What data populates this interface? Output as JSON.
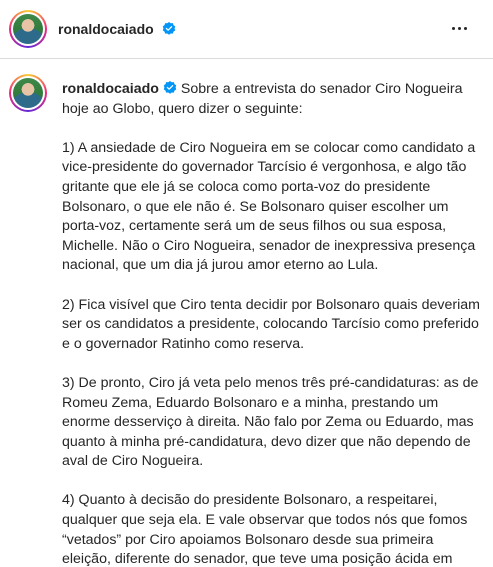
{
  "header": {
    "username": "ronaldocaiado",
    "more_icon": "more-horizontal-icon",
    "verified_icon": "verified-badge-icon",
    "verified_color": "#0095f6"
  },
  "caption": {
    "username": "ronaldocaiado",
    "intro": "Sobre a entrevista do senador Ciro Nogueira hoje ao Globo, quero dizer o seguinte:",
    "paragraphs": [
      "1) A ansiedade de Ciro Nogueira em se colocar como candidato a vice-presidente do governador Tarcísio é vergonhosa, e algo tão gritante que ele já se coloca como porta-voz do presidente Bolsonaro, o que ele não é. Se Bolsonaro quiser escolher um porta-voz, certamente será um de seus filhos ou sua esposa, Michelle. Não o Ciro Nogueira, senador de inexpressiva presença nacional, que um dia já jurou amor eterno ao Lula.",
      "2) Fica visível que Ciro tenta decidir por Bolsonaro quais deveriam ser os candidatos a presidente, colocando Tarcísio como preferido e o governador Ratinho como reserva.",
      "3) De pronto, Ciro já veta pelo menos três pré-candidaturas: as de Romeu Zema, Eduardo Bolsonaro e a minha, prestando um enorme desserviço à direita. Não falo por Zema ou Eduardo, mas quanto à minha pré-candidatura, devo dizer que não dependo de aval de Ciro Nogueira.",
      "4) Quanto à decisão do presidente Bolsonaro, a respeitarei, qualquer que seja ela. E vale observar que todos nós que fomos “vetados” por Ciro apoiamos Bolsonaro desde sua primeira eleição, diferente do senador, que teve uma posição ácida em relação ao ex-presidente."
    ]
  }
}
